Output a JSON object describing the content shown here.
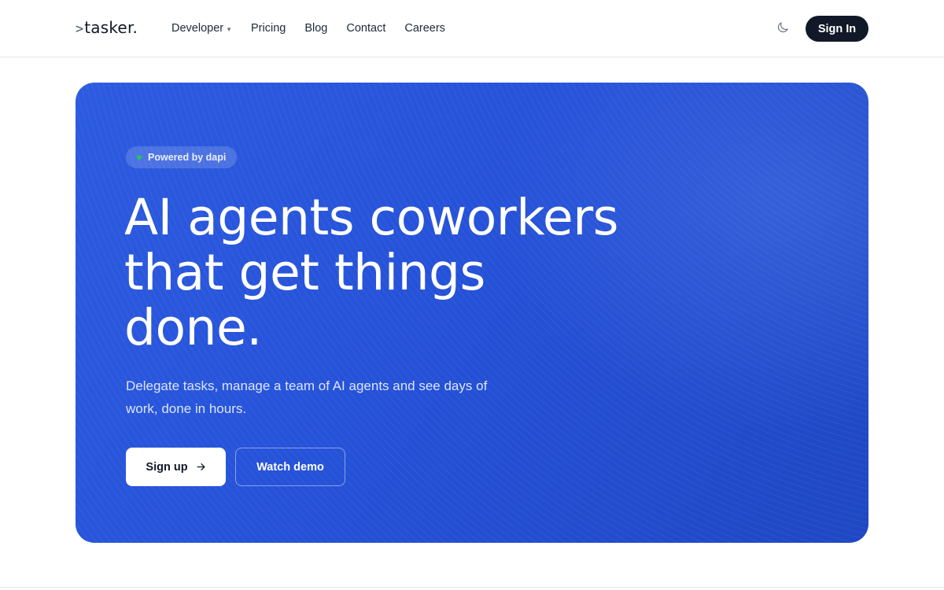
{
  "header": {
    "logo_prompt": ">",
    "logo_text": "tasker.",
    "nav": [
      {
        "label": "Developer",
        "has_dropdown": true
      },
      {
        "label": "Pricing"
      },
      {
        "label": "Blog"
      },
      {
        "label": "Contact"
      },
      {
        "label": "Careers"
      }
    ],
    "theme_toggle_icon": "moon-icon",
    "signin_label": "Sign In"
  },
  "hero": {
    "badge_label": "Powered by dapi",
    "badge_dot_color": "#22c55e",
    "headline_lines": [
      "AI agents coworkers",
      "that get things",
      "done."
    ],
    "subtitle_lines": [
      "Delegate tasks, manage a team of AI agents and see days of",
      "work, done in hours."
    ],
    "primary_cta": "Sign up",
    "primary_cta_icon": "arrow-right-icon",
    "secondary_cta": "Watch demo",
    "accent_color": "#2552d8"
  }
}
